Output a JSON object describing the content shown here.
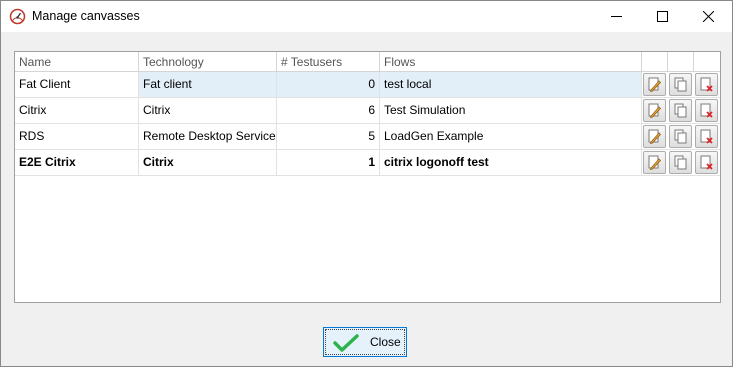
{
  "window": {
    "title": "Manage canvasses",
    "icons": {
      "app": "speedometer-icon",
      "minimize": "minimize-icon",
      "maximize": "maximize-icon",
      "close": "close-icon"
    }
  },
  "table": {
    "columns": [
      "Name",
      "Technology",
      "# Testusers",
      "Flows"
    ],
    "rows": [
      {
        "name": "Fat Client",
        "technology": "Fat client",
        "testusers": "0",
        "flows": "test local",
        "selected": true,
        "bold": false
      },
      {
        "name": "Citrix",
        "technology": "Citrix",
        "testusers": "6",
        "flows": "Test Simulation",
        "selected": false,
        "bold": false
      },
      {
        "name": "RDS",
        "technology": "Remote Desktop Services",
        "testusers": "5",
        "flows": "LoadGen Example",
        "selected": false,
        "bold": false
      },
      {
        "name": "E2E Citrix",
        "technology": "Citrix",
        "testusers": "1",
        "flows": "citrix logonoff test",
        "selected": false,
        "bold": true
      }
    ],
    "row_actions": [
      "edit-icon",
      "copy-icon",
      "delete-icon"
    ]
  },
  "footer": {
    "close_label": "Close",
    "close_icon": "checkmark-icon"
  },
  "colors": {
    "selected_row": "#e2eef8",
    "accent": "#0078d7",
    "check": "#2db34a",
    "delete": "#d9262c"
  }
}
